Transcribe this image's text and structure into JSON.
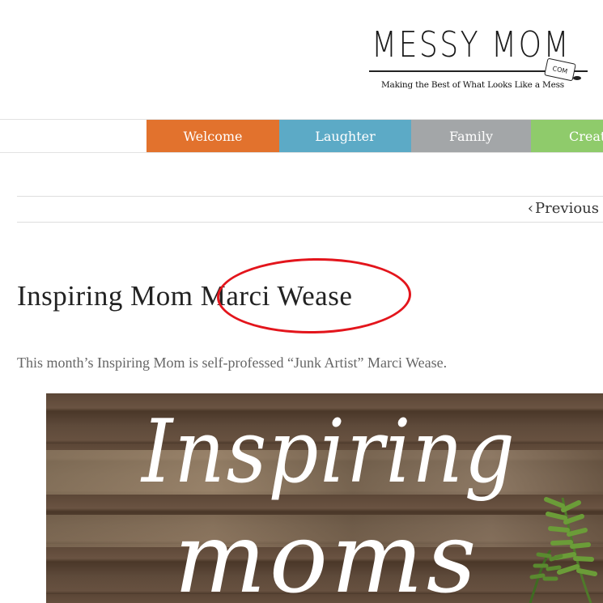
{
  "logo": {
    "title": "MESSY MOM",
    "can_label": "COM",
    "tagline": "Making the Best of What Looks Like a Mess"
  },
  "nav": {
    "items": [
      {
        "label": "Welcome",
        "color": "#e2722d"
      },
      {
        "label": "Laughter",
        "color": "#5caac6"
      },
      {
        "label": "Family",
        "color": "#a3a6a8"
      },
      {
        "label": "Creati",
        "color": "#8fcb6b"
      }
    ]
  },
  "post_nav": {
    "previous_label": "Previous",
    "previous_icon": "chevron-left-icon"
  },
  "post": {
    "title": "Inspiring Mom Marci Wease",
    "intro": "This month’s Inspiring Mom is self-professed “Junk Artist” Marci Wease.",
    "highlight_color": "#e3151c"
  },
  "featured_image": {
    "line1": "Inspiring",
    "line2": "moms"
  }
}
